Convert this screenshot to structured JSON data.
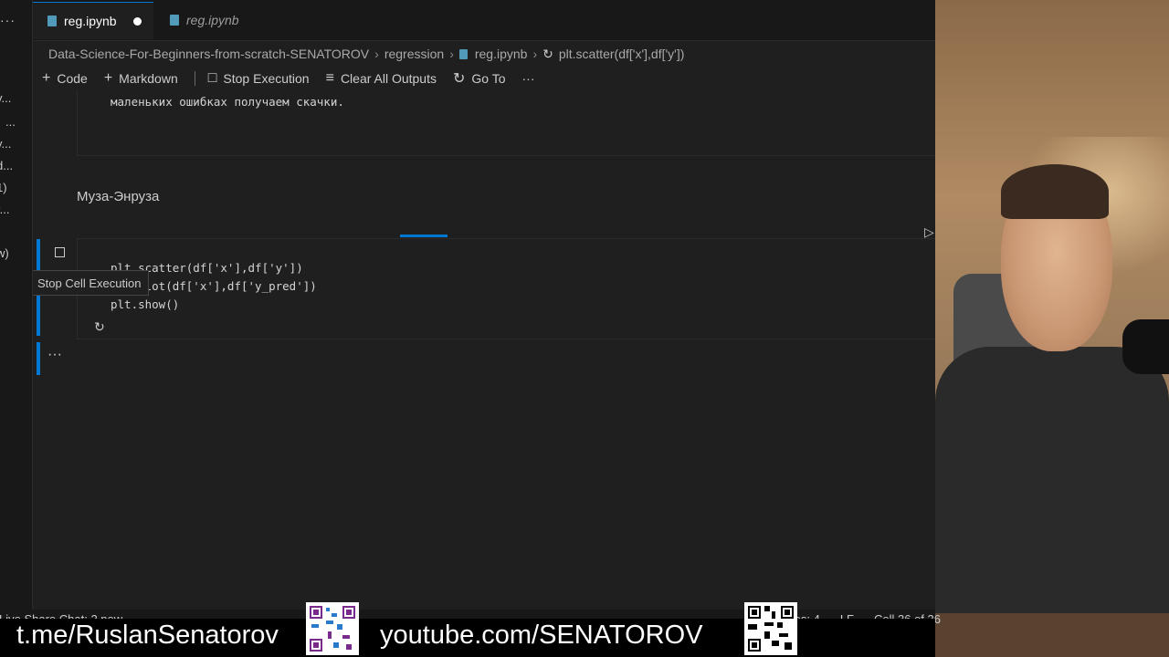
{
  "sidebar": {
    "fragments": [
      "y...",
      "...",
      "y...",
      "d...",
      "1)",
      "r...",
      "w)"
    ]
  },
  "tabs": [
    {
      "label": "reg.ipynb",
      "active": true,
      "dirty": true
    },
    {
      "label": "reg.ipynb",
      "active": false
    }
  ],
  "breadcrumb": {
    "items": [
      "Data-Science-For-Beginners-from-scratch-SENATOROV",
      "regression",
      "reg.ipynb",
      "plt.scatter(df['x'],df['y'])"
    ]
  },
  "toolbar": {
    "code": "Code",
    "markdown": "Markdown",
    "stop_execution": "Stop Execution",
    "clear_all_outputs": "Clear All Outputs",
    "go_to": "Go To",
    "more": "···"
  },
  "markdown_cell": {
    "text": "маленьких ошибках получаем скачки."
  },
  "heading": "Муза-Энруза",
  "code_cell": {
    "lines": [
      "plt.scatter(df['x'],df['y'])",
      "plt.plot(df['x'],df['y_pred'])",
      "plt.show()"
    ],
    "tooltip": "Stop Cell Execution"
  },
  "output_dots": "···",
  "statusbar": {
    "left": "Live Share Chat: 2 new",
    "spaces": "Spaces: 4",
    "eol": "LF",
    "cell": "Cell 36 of 36"
  },
  "overlay": {
    "telegram": "t.me/RuslanSenatorov",
    "youtube": "youtube.com/SENATOROV"
  },
  "colors": {
    "accent": "#0078d4",
    "editor_bg": "#1f1f1f",
    "sidebar_bg": "#181818"
  }
}
